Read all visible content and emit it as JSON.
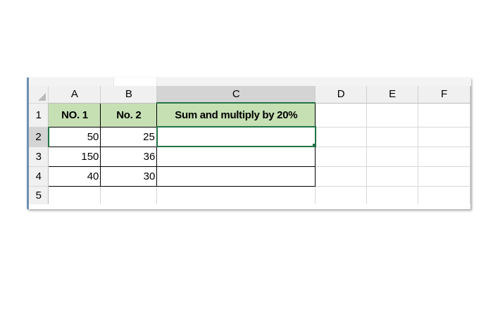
{
  "columns": [
    "A",
    "B",
    "C",
    "D",
    "E",
    "F"
  ],
  "selected_column": "C",
  "rows": [
    "1",
    "2",
    "3",
    "4",
    "5"
  ],
  "selected_row": "2",
  "headers": {
    "A1": "NO. 1",
    "B1": "No. 2",
    "C1": "Sum and multiply by 20%"
  },
  "cells": {
    "A2": "50",
    "B2": "25",
    "C2": "",
    "A3": "150",
    "B3": "36",
    "C3": "",
    "A4": "40",
    "B4": "30",
    "C4": ""
  },
  "active_cell": "C2",
  "colors": {
    "header_fill": "#c6e0b4",
    "selection_accent": "#217346",
    "header_band": "#f0f0f0"
  }
}
